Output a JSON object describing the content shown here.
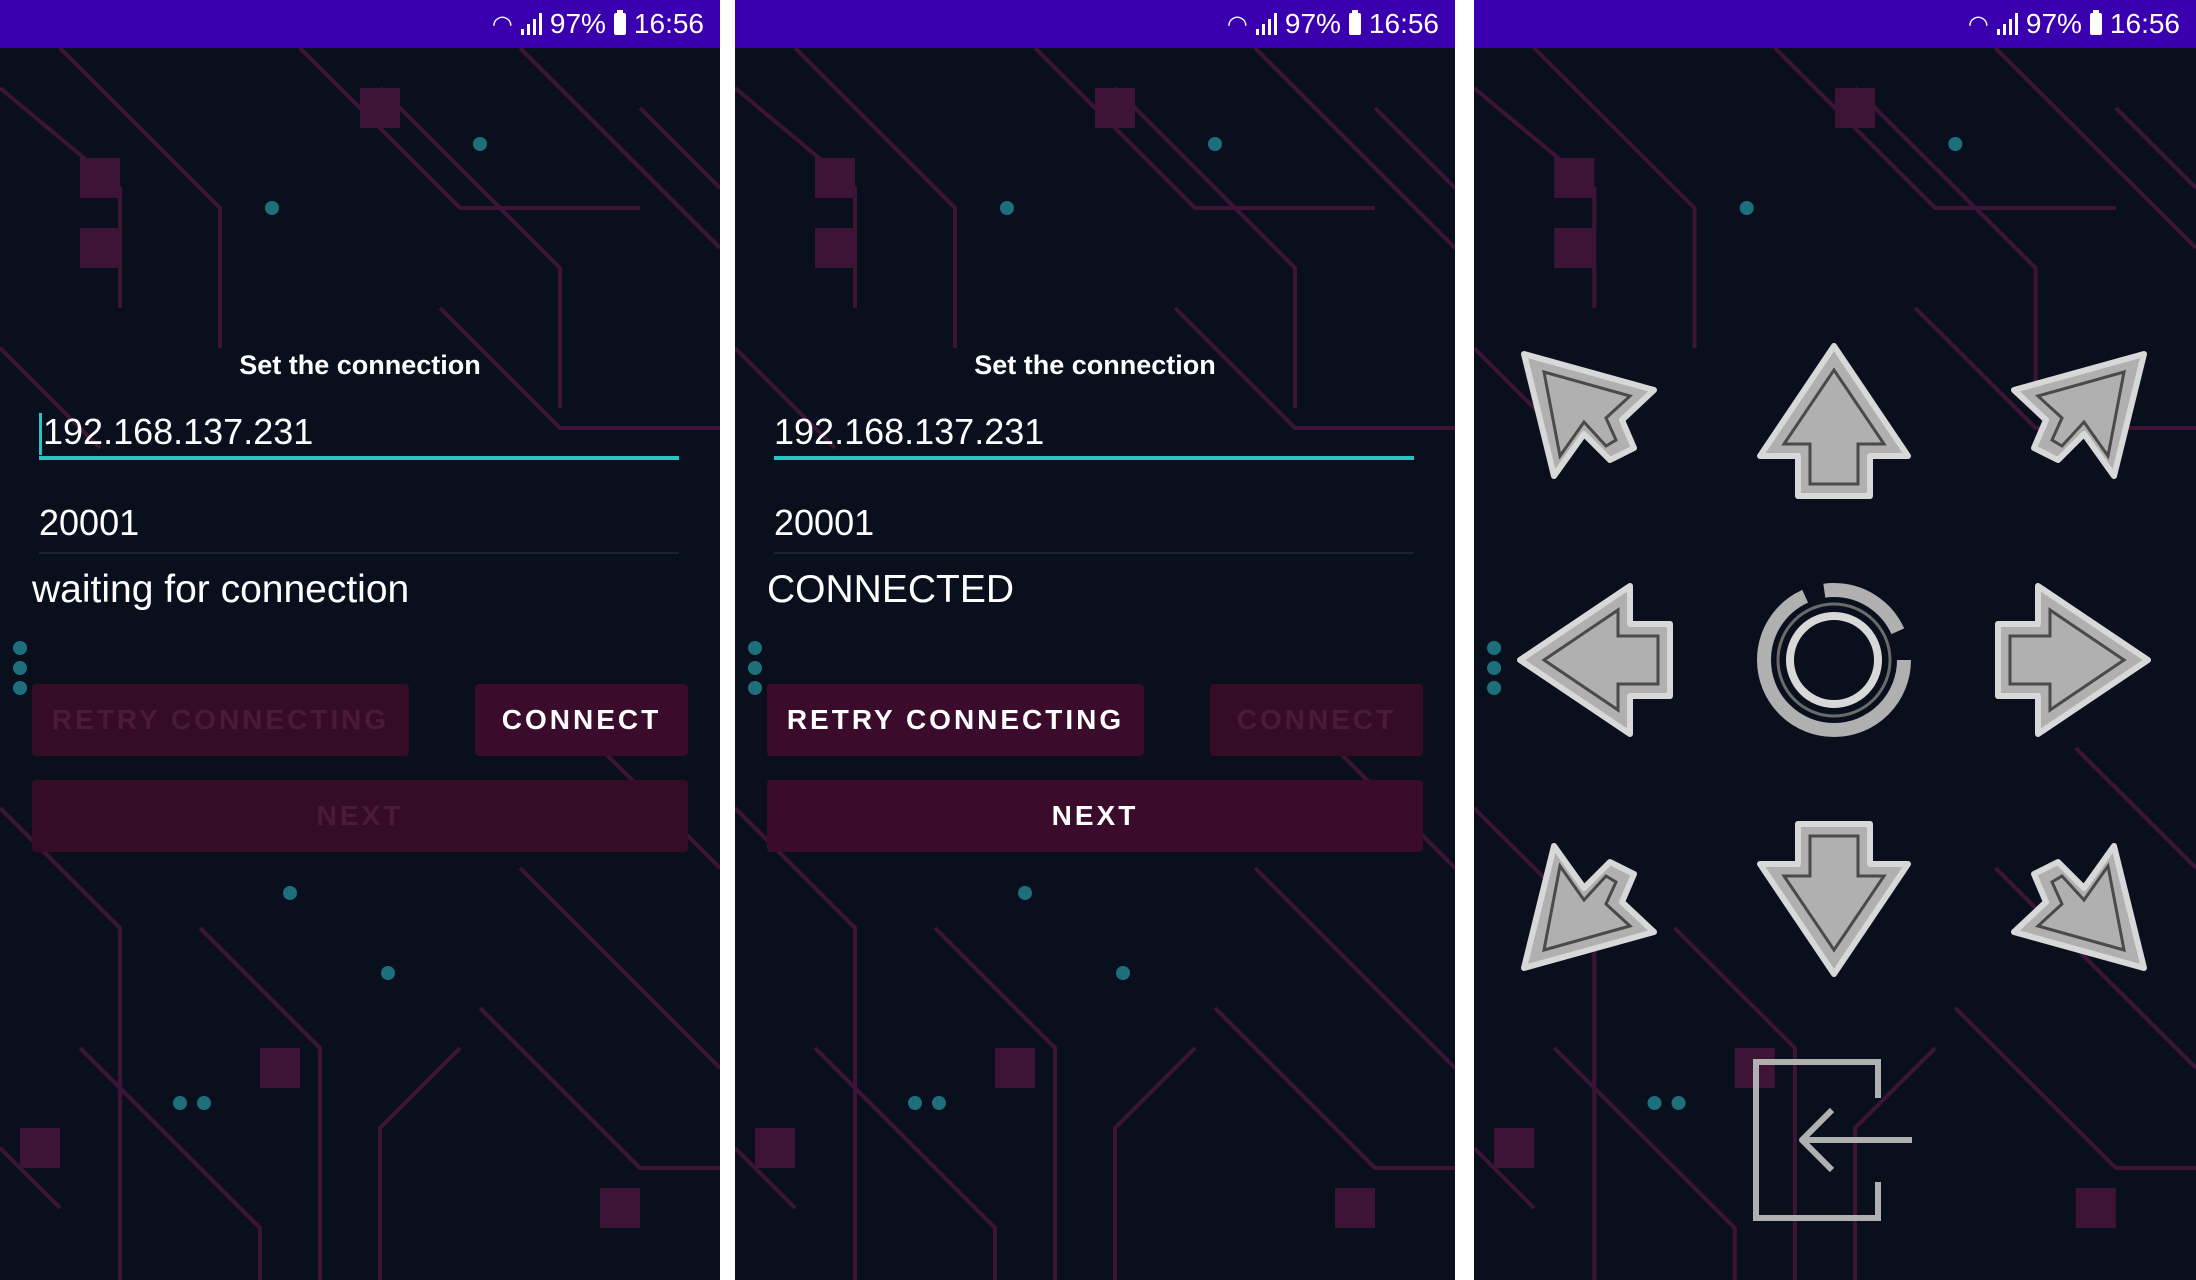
{
  "status_bar": {
    "battery": "97%",
    "time": "16:56"
  },
  "screens": [
    {
      "title": "Set the connection",
      "ip_value": "192.168.137.231",
      "port_value": "20001",
      "status_text": "waiting for connection",
      "retry_label": "RETRY CONNECTING",
      "connect_label": "CONNECT",
      "next_label": "NEXT"
    },
    {
      "title": "Set the connection",
      "ip_value": "192.168.137.231",
      "port_value": "20001",
      "status_text": "CONNECTED",
      "retry_label": "RETRY CONNECTING",
      "connect_label": "CONNECT",
      "next_label": "NEXT"
    }
  ],
  "control_pad": {
    "buttons": [
      "arrow-up-left-icon",
      "arrow-up-icon",
      "arrow-up-right-icon",
      "arrow-left-icon",
      "rotate-center-icon",
      "arrow-right-icon",
      "arrow-down-left-icon",
      "arrow-down-icon",
      "arrow-down-right-icon",
      "back-exit-icon"
    ]
  },
  "colors": {
    "statusbar": "#3a00b0",
    "accent": "#2cc4c0",
    "button": "#3a0b2b",
    "background": "#0a0f1e",
    "icon": "#b0b0b0"
  }
}
